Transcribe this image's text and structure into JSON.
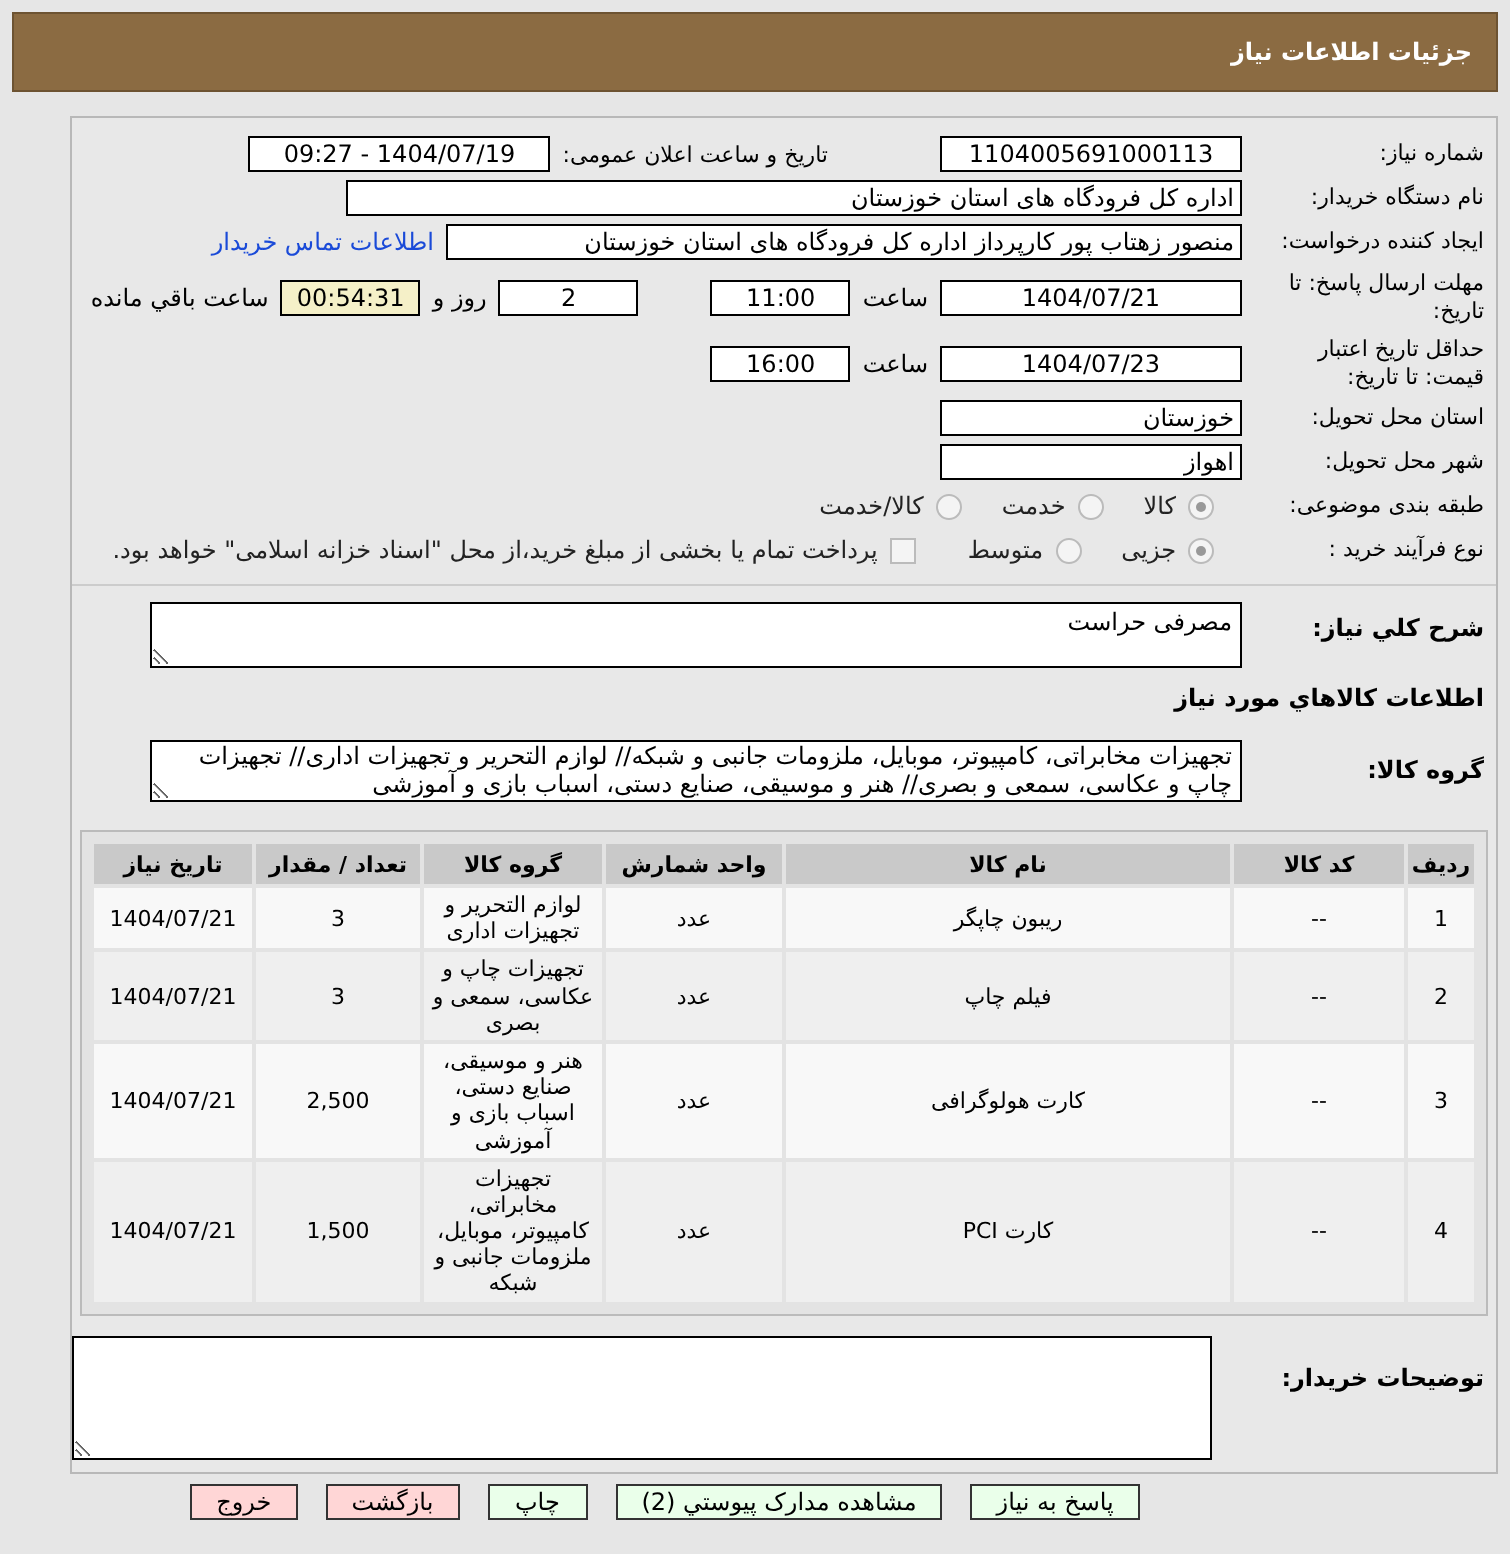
{
  "header": {
    "title": "جزئیات اطلاعات نیاز"
  },
  "need_number": {
    "label": "شماره نیاز:",
    "value": "1104005691000113"
  },
  "announce": {
    "label": "تاریخ و ساعت اعلان عمومی:",
    "value": "1404/07/19 - 09:27"
  },
  "buyer_org": {
    "label": "نام دستگاه خریدار:",
    "value": "اداره کل فرودگاه های استان خوزستان"
  },
  "creator": {
    "label": "ایجاد کننده درخواست:",
    "value": "منصور زهتاب پور کارپرداز اداره کل فرودگاه های استان خوزستان",
    "link": "اطلاعات تماس خریدار"
  },
  "deadline": {
    "label": "مهلت ارسال پاسخ: تا تاریخ:",
    "date": "1404/07/21",
    "time_label": "ساعت",
    "time": "11:00",
    "days": "2",
    "days_label": "روز و",
    "remaining": "00:54:31",
    "remaining_label": "ساعت باقي مانده"
  },
  "validity": {
    "label": "حداقل تاریخ اعتبار قیمت: تا تاریخ:",
    "date": "1404/07/23",
    "time_label": "ساعت",
    "time": "16:00"
  },
  "province": {
    "label": "استان محل تحویل:",
    "value": "خوزستان"
  },
  "city": {
    "label": "شهر محل تحویل:",
    "value": "اهواز"
  },
  "category": {
    "label": "طبقه بندی موضوعی:",
    "options": [
      {
        "label": "کالا",
        "selected": true
      },
      {
        "label": "خدمت",
        "selected": false
      },
      {
        "label": "کالا/خدمت",
        "selected": false
      }
    ]
  },
  "process": {
    "label": "نوع فرآیند خرید :",
    "options": [
      {
        "label": "جزیی",
        "selected": true
      },
      {
        "label": "متوسط",
        "selected": false
      }
    ],
    "treasury": {
      "label": "پرداخت تمام یا بخشی از مبلغ خرید،از محل \"اسناد خزانه اسلامی\" خواهد بود.",
      "checked": false
    }
  },
  "description": {
    "label": "شرح کلي نياز:",
    "value": "مصرفی حراست"
  },
  "goods_heading": "اطلاعات کالاهاي مورد نياز",
  "goods_group": {
    "label": "گروه کالا:",
    "value": "تجهیزات مخابراتی، کامپیوتر، موبایل، ملزومات جانبی و شبکه// لوازم التحریر و تجهیزات اداری// تجهیزات چاپ و عکاسی، سمعی و بصری// هنر و موسیقی، صنایع دستی، اسباب بازی و آموزشی"
  },
  "table": {
    "columns": [
      "ردیف",
      "کد کالا",
      "نام کالا",
      "واحد شمارش",
      "گروه کالا",
      "تعداد / مقدار",
      "تاریخ نیاز"
    ],
    "rows": [
      [
        "1",
        "--",
        "ریبون چاپگر",
        "عدد",
        "لوازم التحریر و تجهیزات اداری",
        "3",
        "1404/07/21"
      ],
      [
        "2",
        "--",
        "فیلم چاپ",
        "عدد",
        "تجهیزات چاپ و عکاسی، سمعی و بصری",
        "3",
        "1404/07/21"
      ],
      [
        "3",
        "--",
        "کارت هولوگرافی",
        "عدد",
        "هنر و موسیقی، صنایع دستی، اسباب بازی و آموزشی",
        "2,500",
        "1404/07/21"
      ],
      [
        "4",
        "--",
        "کارت PCI",
        "عدد",
        "تجهیزات مخابراتی، کامپیوتر، موبایل، ملزومات جانبی و شبکه",
        "1,500",
        "1404/07/21"
      ]
    ]
  },
  "buyer_notes": {
    "label": "توضیحات خریدار:"
  },
  "buttons": [
    {
      "label": "پاسخ به نیاز",
      "kind": "action"
    },
    {
      "label": "مشاهده مدارک پیوستي (2)",
      "kind": "action"
    },
    {
      "label": "چاپ",
      "kind": "action"
    },
    {
      "label": "بازگشت",
      "kind": "exit"
    },
    {
      "label": "خروج",
      "kind": "exit"
    }
  ]
}
